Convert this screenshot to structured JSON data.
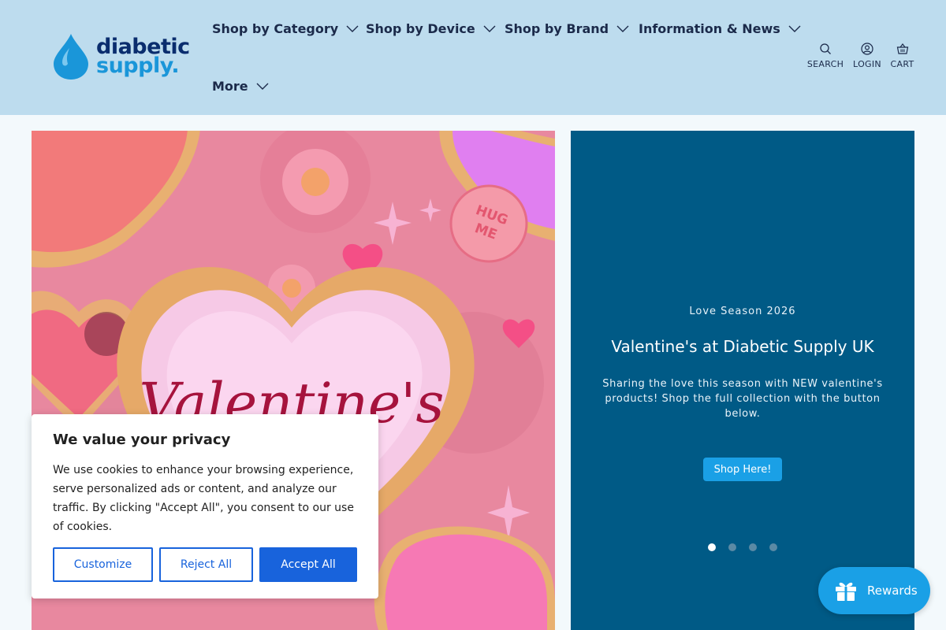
{
  "brand": {
    "logo_line1": "diabetic",
    "logo_line2": "supply.",
    "colors": {
      "dark_blue": "#0a2d6e",
      "light_blue": "#1a96d9",
      "header_bg": "#bddcee"
    }
  },
  "nav": {
    "items": [
      {
        "label": "Shop by Category",
        "icon": "chevron-down-icon"
      },
      {
        "label": "Shop by Device",
        "icon": "chevron-down-icon"
      },
      {
        "label": "Shop by Brand",
        "icon": "chevron-down-icon"
      },
      {
        "label": "Information & News",
        "icon": "chevron-down-icon"
      },
      {
        "label": "More",
        "icon": "chevron-down-icon"
      }
    ]
  },
  "utility": {
    "search": {
      "label": "SEARCH",
      "icon": "search-icon"
    },
    "login": {
      "label": "LOGIN",
      "icon": "user-icon"
    },
    "cart": {
      "label": "CART",
      "icon": "basket-icon"
    }
  },
  "hero": {
    "image_text": "Valentine's",
    "heart_stamp": "HUG ME",
    "eyebrow": "Love Season 2026",
    "title": "Valentine's at Diabetic Supply UK",
    "description": "Sharing the love this season with NEW valentine's products! Shop the full collection with the button below.",
    "button_label": "Shop Here!",
    "slides_count": 4,
    "active_slide": 1,
    "panel_color": "#005a86"
  },
  "cookie": {
    "title": "We value your privacy",
    "text": "We use cookies to enhance your browsing experience, serve personalized ads or content, and analyze our traffic. By clicking \"Accept All\", you consent to our use of cookies.",
    "customize_label": "Customize",
    "reject_label": "Reject All",
    "accept_label": "Accept All",
    "accent": "#1863dc"
  },
  "rewards": {
    "label": "Rewards",
    "icon": "gift-icon"
  }
}
